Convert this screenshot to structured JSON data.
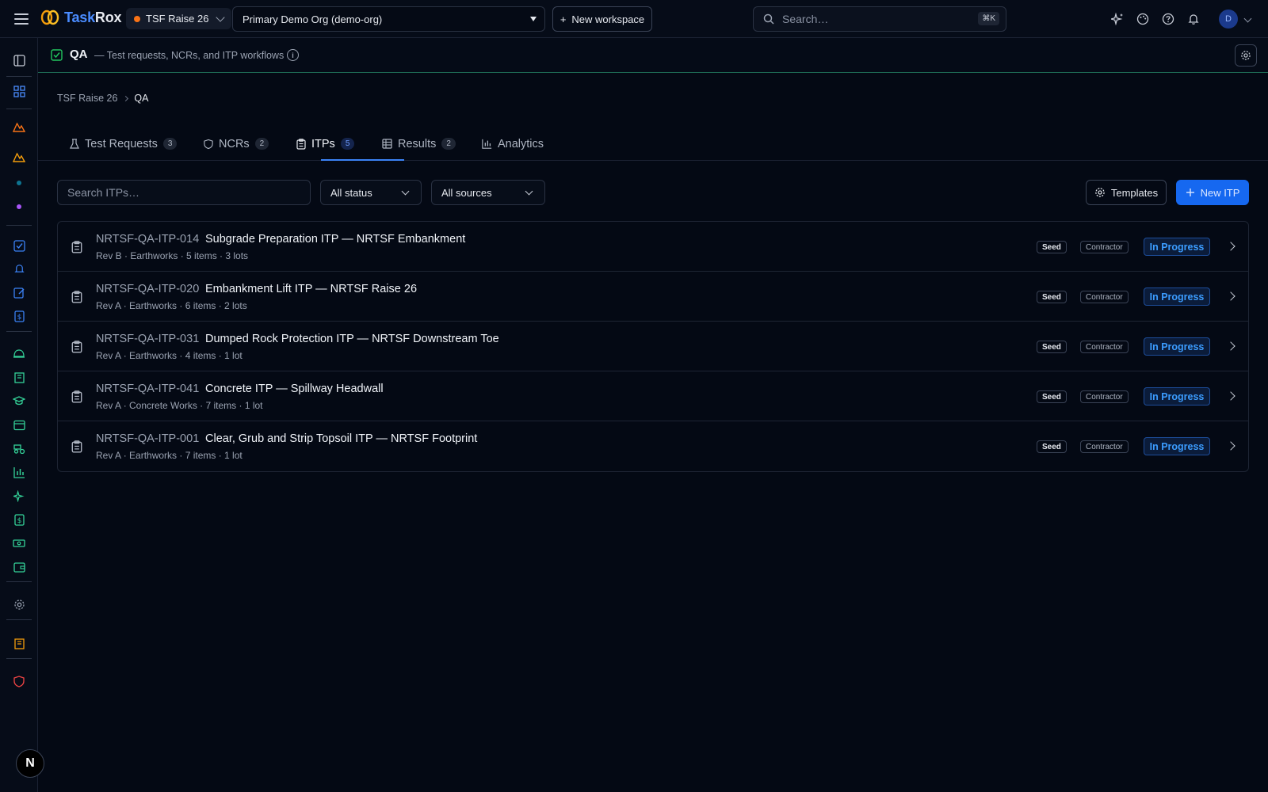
{
  "app": {
    "brand_part1": "Task",
    "brand_part2": "Rox",
    "project": "TSF Raise 26",
    "org": "Primary Demo Org (demo-org)",
    "new_workspace": "New workspace",
    "search_placeholder": "Search…",
    "search_shortcut": "⌘K",
    "avatar_initial": "D"
  },
  "section": {
    "title": "QA",
    "subtitle": "— Test requests, NCRs, and ITP workflows"
  },
  "breadcrumb": [
    "TSF Raise 26",
    "QA"
  ],
  "tabs": [
    {
      "label": "Test Requests",
      "count": "3"
    },
    {
      "label": "NCRs",
      "count": "2"
    },
    {
      "label": "ITPs",
      "count": "5"
    },
    {
      "label": "Results",
      "count": "2"
    },
    {
      "label": "Analytics"
    }
  ],
  "filters": {
    "search_placeholder": "Search ITPs…",
    "status": "All status",
    "sources": "All sources",
    "templates": "Templates",
    "new_itp": "New ITP"
  },
  "itps": [
    {
      "code": "NRTSF-QA-ITP-014",
      "title": "Subgrade Preparation ITP — NRTSF Embankment",
      "meta": "Rev B · Earthworks · 5 items · 3 lots",
      "tag1": "Seed",
      "tag2": "Contractor",
      "status": "In Progress"
    },
    {
      "code": "NRTSF-QA-ITP-020",
      "title": "Embankment Lift ITP — NRTSF Raise 26",
      "meta": "Rev A · Earthworks · 6 items · 2 lots",
      "tag1": "Seed",
      "tag2": "Contractor",
      "status": "In Progress"
    },
    {
      "code": "NRTSF-QA-ITP-031",
      "title": "Dumped Rock Protection ITP — NRTSF Downstream Toe",
      "meta": "Rev A · Earthworks · 4 items · 1 lot",
      "tag1": "Seed",
      "tag2": "Contractor",
      "status": "In Progress"
    },
    {
      "code": "NRTSF-QA-ITP-041",
      "title": "Concrete ITP — Spillway Headwall",
      "meta": "Rev A · Concrete Works · 7 items · 1 lot",
      "tag1": "Seed",
      "tag2": "Contractor",
      "status": "In Progress"
    },
    {
      "code": "NRTSF-QA-ITP-001",
      "title": "Clear, Grub and Strip Topsoil ITP — NRTSF Footprint",
      "meta": "Rev A · Earthworks · 7 items · 1 lot",
      "tag1": "Seed",
      "tag2": "Contractor",
      "status": "In Progress"
    }
  ],
  "rail_bubble": "N",
  "colors": {
    "accent": "#3b82f6",
    "brand_blue": "#4a8cff",
    "status_blue": "#3b9cff",
    "qa_green": "#22c55e"
  }
}
